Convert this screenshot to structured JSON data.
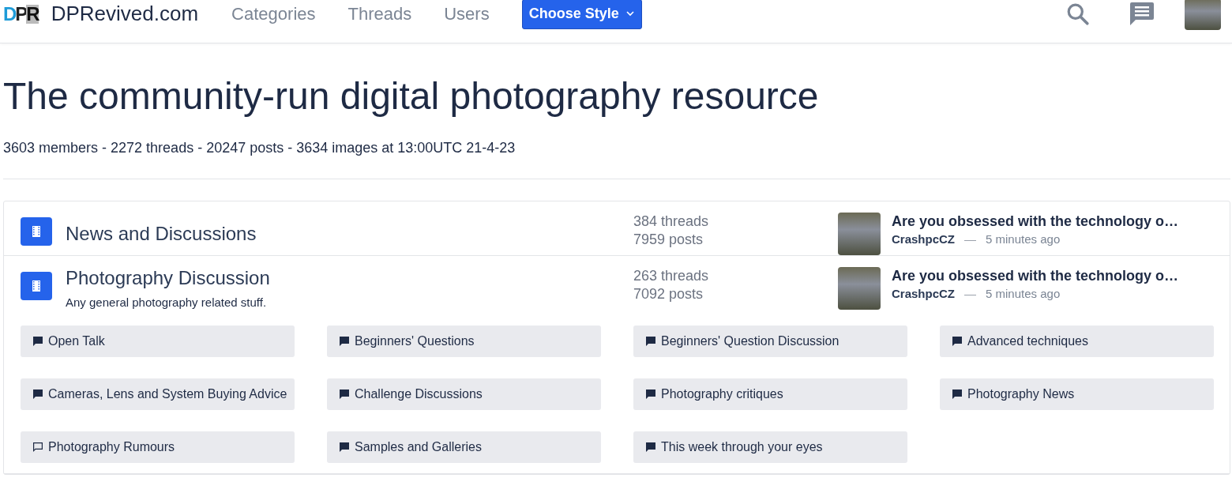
{
  "header": {
    "logo": "DPR",
    "site_name": "DPRevived.com",
    "nav": [
      "Categories",
      "Threads",
      "Users"
    ],
    "style_button": "Choose Style"
  },
  "hero": {
    "title": "The community-run digital photography resource",
    "stats": "3603 members - 2272 threads - 20247 posts - 3634 images at 13:00UTC 21-4-23"
  },
  "categories": [
    {
      "name": "News and Discussions",
      "threads": "384 threads",
      "posts": "7959 posts",
      "latest": {
        "title": "Are you obsessed with the technology o…",
        "user": "CrashpcCZ",
        "separator": "—",
        "time": "5 minutes ago"
      }
    },
    {
      "name": "Photography Discussion",
      "description": "Any general photography related stuff.",
      "threads": "263 threads",
      "posts": "7092 posts",
      "latest": {
        "title": "Are you obsessed with the technology o…",
        "user": "CrashpcCZ",
        "separator": "—",
        "time": "5 minutes ago"
      },
      "subforums": [
        {
          "label": "Open Talk",
          "has_new": true
        },
        {
          "label": "Beginners' Questions",
          "has_new": true
        },
        {
          "label": "Beginners' Question Discussion",
          "has_new": true
        },
        {
          "label": "Advanced techniques",
          "has_new": true
        },
        {
          "label": "Cameras, Lens and System Buying Advice",
          "has_new": true
        },
        {
          "label": "Challenge Discussions",
          "has_new": true
        },
        {
          "label": "Photography critiques",
          "has_new": true
        },
        {
          "label": "Photography News",
          "has_new": true
        },
        {
          "label": "Photography Rumours",
          "has_new": false
        },
        {
          "label": "Samples and Galleries",
          "has_new": true
        },
        {
          "label": "This week through your eyes",
          "has_new": true
        }
      ]
    }
  ]
}
